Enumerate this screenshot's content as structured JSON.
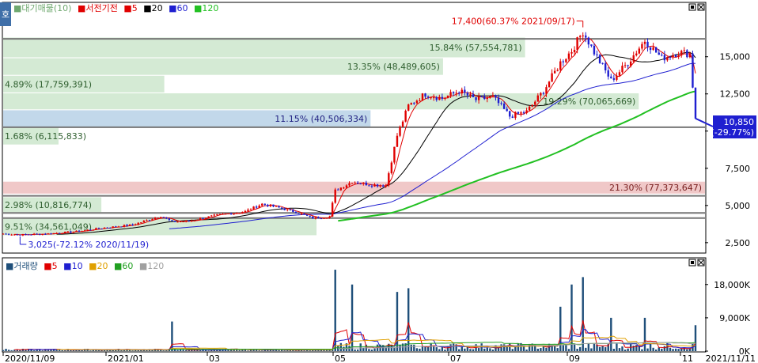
{
  "chart_data": [
    {
      "type": "candlestick",
      "panel": "price",
      "corner_tab": "호",
      "legend": [
        {
          "label": "■대기매물(10)",
          "color": "#8fbf8f"
        },
        {
          "label": "■서전기전",
          "color": "#e00000"
        },
        {
          "label": "■5",
          "color": "#e00000"
        },
        {
          "label": "■20",
          "color": "#000000"
        },
        {
          "label": "■60",
          "color": "#1f1fd0"
        },
        {
          "label": "■120",
          "color": "#22c022"
        }
      ],
      "ylim": [
        1800,
        18600
      ],
      "y_ticks": [
        {
          "value": 15000,
          "label": "15,000"
        },
        {
          "value": 12500,
          "label": "12,500"
        },
        {
          "value": 10000,
          "label": "10,000"
        },
        {
          "value": 7500,
          "label": "7,500"
        },
        {
          "value": 5000,
          "label": "5,000"
        },
        {
          "value": 2500,
          "label": "2,500"
        }
      ],
      "current_price": {
        "value": 10850,
        "label": "10,850",
        "change": "(-29.77%)"
      },
      "volume_profile": [
        {
          "low": 14960,
          "high": 16290,
          "pct": 15.84,
          "label": "15.84% (57,554,781)",
          "color": "#d4ead4"
        },
        {
          "low": 13780,
          "high": 14900,
          "pct": 13.35,
          "label": "13.35% (48,489,605)",
          "color": "#d4ead4"
        },
        {
          "low": 12600,
          "high": 13720,
          "pct": 4.89,
          "label": "4.89% (17,759,391)",
          "color": "#d4ead4"
        },
        {
          "low": 11460,
          "high": 12540,
          "pct": 19.29,
          "label": "19.29% (70,065,669)",
          "color": "#d4ead4"
        },
        {
          "low": 10260,
          "high": 11400,
          "pct": 11.15,
          "label": "11.15% (40,506,334)",
          "color": "#c2d8ea"
        },
        {
          "low": 9100,
          "high": 10220,
          "pct": 1.68,
          "label": "1.68% (6,115,833)",
          "color": "#d4ead4"
        },
        {
          "low": 5800,
          "high": 6600,
          "pct": 21.3,
          "label": "21.30% (77,373,647)",
          "color": "#f0c8c8"
        },
        {
          "low": 4550,
          "high": 5550,
          "pct": 2.98,
          "label": "2.98% (10,816,774)",
          "color": "#d4ead4"
        },
        {
          "low": 3000,
          "high": 4150,
          "pct": 9.51,
          "label": "9.51% (34,561,049)",
          "color": "#d4ead4"
        }
      ],
      "support_lines": [
        16200,
        10260,
        5650,
        4500,
        4150
      ],
      "annotations": [
        {
          "text": "17,400(60.37% 2021/09/17)",
          "value": 17400,
          "kind": "high"
        },
        {
          "text": "3,025(-72.12% 2020/11/19)",
          "value": 3025,
          "kind": "low"
        }
      ],
      "x_ticks": [
        "2020/11/09",
        "2021/01",
        "03",
        "05",
        "07",
        "09",
        "11",
        "2021/11/11"
      ],
      "price_path": [
        [
          0,
          3100
        ],
        [
          6,
          3030
        ],
        [
          16,
          3100
        ],
        [
          26,
          3250
        ],
        [
          36,
          3500
        ],
        [
          46,
          3700
        ],
        [
          56,
          4300
        ],
        [
          60,
          3900
        ],
        [
          66,
          3950
        ],
        [
          76,
          4350
        ],
        [
          86,
          4600
        ],
        [
          92,
          5100
        ],
        [
          98,
          4850
        ],
        [
          104,
          4550
        ],
        [
          110,
          4150
        ],
        [
          116,
          4250
        ],
        [
          118,
          6000
        ],
        [
          124,
          6600
        ],
        [
          130,
          6400
        ],
        [
          136,
          6350
        ],
        [
          140,
          9700
        ],
        [
          144,
          11700
        ],
        [
          150,
          12500
        ],
        [
          156,
          12200
        ],
        [
          162,
          12700
        ],
        [
          168,
          12100
        ],
        [
          174,
          12300
        ],
        [
          180,
          11000
        ],
        [
          186,
          11300
        ],
        [
          192,
          12700
        ],
        [
          198,
          14600
        ],
        [
          202,
          15400
        ],
        [
          206,
          16700
        ],
        [
          210,
          15300
        ],
        [
          216,
          13400
        ],
        [
          222,
          14600
        ],
        [
          228,
          16100
        ],
        [
          234,
          14900
        ],
        [
          240,
          15300
        ],
        [
          244,
          15200
        ],
        [
          246,
          10850
        ]
      ],
      "ma_periods": [
        5,
        20,
        60,
        120
      ]
    },
    {
      "type": "bar",
      "panel": "volume",
      "legend": [
        {
          "label": "■거래량",
          "color": "#1f4f7a"
        },
        {
          "label": "■5",
          "color": "#e00000"
        },
        {
          "label": "■10",
          "color": "#1f1fd0"
        },
        {
          "label": "■20",
          "color": "#e0a000"
        },
        {
          "label": "■60",
          "color": "#22a022"
        },
        {
          "label": "■120",
          "color": "#a0a0a0"
        }
      ],
      "ylim": [
        0,
        25000
      ],
      "y_ticks": [
        {
          "value": 18000,
          "label": "18,000K"
        },
        {
          "value": 9000,
          "label": "9,000K"
        },
        {
          "value": 0,
          "label": "0K"
        }
      ],
      "spikes": [
        {
          "day": 60,
          "value": 8000
        },
        {
          "day": 118,
          "value": 22000
        },
        {
          "day": 124,
          "value": 18000
        },
        {
          "day": 140,
          "value": 16000
        },
        {
          "day": 144,
          "value": 17000
        },
        {
          "day": 198,
          "value": 12000
        },
        {
          "day": 202,
          "value": 18000
        },
        {
          "day": 206,
          "value": 20000
        },
        {
          "day": 216,
          "value": 9000
        },
        {
          "day": 228,
          "value": 9000
        },
        {
          "day": 246,
          "value": 7000
        }
      ]
    }
  ]
}
